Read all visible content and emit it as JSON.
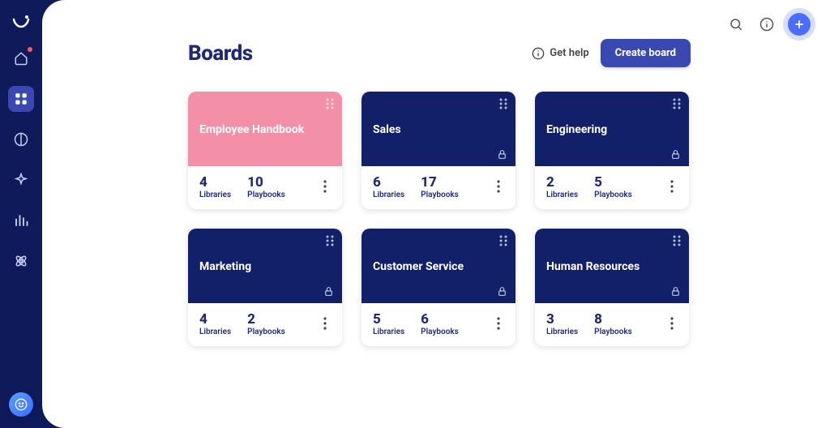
{
  "sidebar": {
    "items": [
      {
        "icon": "smile",
        "active": false,
        "notify": false
      },
      {
        "icon": "home",
        "active": false,
        "notify": true
      },
      {
        "icon": "grid",
        "active": true,
        "notify": false
      },
      {
        "icon": "coffee",
        "active": false,
        "notify": false
      },
      {
        "icon": "sparkle",
        "active": false,
        "notify": false
      },
      {
        "icon": "bars",
        "active": false,
        "notify": false
      },
      {
        "icon": "atom",
        "active": false,
        "notify": false
      }
    ]
  },
  "header": {
    "title": "Boards",
    "help_label": "Get help",
    "create_label": "Create board"
  },
  "boards": [
    {
      "title": "Employee Handbook",
      "libraries": 4,
      "playbooks": 10,
      "color": "pink",
      "locked": false
    },
    {
      "title": "Sales",
      "libraries": 6,
      "playbooks": 17,
      "color": "navy",
      "locked": true
    },
    {
      "title": "Engineering",
      "libraries": 2,
      "playbooks": 5,
      "color": "navy",
      "locked": true
    },
    {
      "title": "Marketing",
      "libraries": 4,
      "playbooks": 2,
      "color": "navy",
      "locked": true
    },
    {
      "title": "Customer Service",
      "libraries": 5,
      "playbooks": 6,
      "color": "navy",
      "locked": true
    },
    {
      "title": "Human Resources",
      "libraries": 3,
      "playbooks": 8,
      "color": "navy",
      "locked": true
    }
  ],
  "labels": {
    "libraries": "Libraries",
    "playbooks": "Playbooks"
  }
}
